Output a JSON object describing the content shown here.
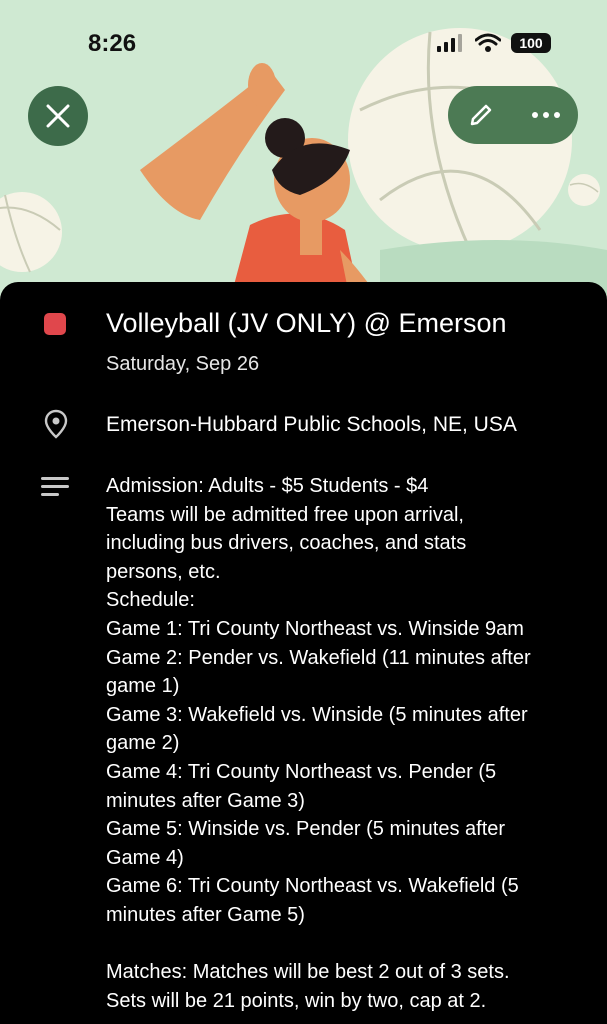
{
  "status_bar": {
    "time": "8:26",
    "battery": "100"
  },
  "toolbar": {
    "close_icon": "close-icon",
    "edit_icon": "pencil-icon",
    "more_icon": "more-horizontal-icon"
  },
  "event": {
    "color": "#e0474c",
    "title": "Volleyball (JV ONLY) @ Emerson",
    "date": "Saturday, Sep 26",
    "location": "Emerson-Hubbard Public Schools, NE, USA",
    "description_lines": [
      "Admission: Adults - $5 Students - $4",
      "Teams will be admitted free upon arrival,",
      "including bus drivers, coaches, and stats",
      "persons, etc.",
      "Schedule:",
      "Game 1: Tri County Northeast vs. Winside 9am",
      "Game 2: Pender vs. Wakefield (11 minutes after",
      "game 1)",
      "Game 3: Wakefield vs. Winside (5 minutes after",
      "game 2)",
      "Game 4: Tri County Northeast vs. Pender (5",
      "minutes after Game 3)",
      "Game 5: Winside vs. Pender (5 minutes after",
      "Game 4)",
      "Game 6: Tri County Northeast vs. Wakefield (5",
      "minutes after Game 5)",
      "",
      "Matches: Matches will be best 2 out of 3 sets.",
      "Sets will be 21 points, win by two, cap at 2."
    ]
  }
}
